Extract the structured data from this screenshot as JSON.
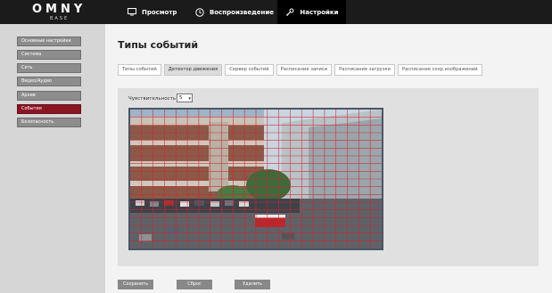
{
  "logo": {
    "main": "OMNY",
    "sub": "BASE"
  },
  "nav": {
    "view": "Просмотр",
    "playback": "Воспроизведение",
    "settings": "Настройки"
  },
  "sidebar": {
    "items": [
      {
        "label": "Основные настройки",
        "active": false
      },
      {
        "label": "Система",
        "active": false
      },
      {
        "label": "Сеть",
        "active": false
      },
      {
        "label": "Видео/Аудио",
        "active": false
      },
      {
        "label": "Архив",
        "active": false
      },
      {
        "label": "События",
        "active": true
      },
      {
        "label": "Безопасность",
        "active": false
      }
    ]
  },
  "main": {
    "title": "Типы событий",
    "tabs": [
      {
        "label": "Типы событий",
        "active": false
      },
      {
        "label": "Детектор движения",
        "active": true
      },
      {
        "label": "Сервер событий",
        "active": false
      },
      {
        "label": "Расписание записи",
        "active": false
      },
      {
        "label": "Расписание загрузки",
        "active": false
      },
      {
        "label": "Расписание сохр.изображений",
        "active": false
      }
    ],
    "sensitivity_label": "Чувствительность",
    "sensitivity_value": "5",
    "grid_color": "#d8202e"
  },
  "buttons": {
    "save": "Сохранить",
    "reset": "Сброс",
    "delete": "Удалить"
  },
  "colors": {
    "topbar": "#1b1b1b",
    "active_sidebar": "#8a1623",
    "sidebar_item": "#8d8d8d"
  }
}
